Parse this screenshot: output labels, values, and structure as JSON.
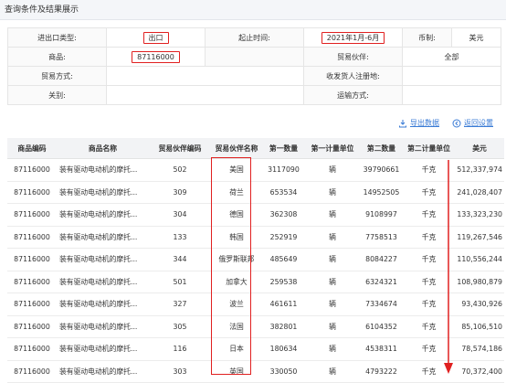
{
  "header": {
    "title": "查询条件及结果展示"
  },
  "criteria": {
    "trade_type_label": "进出口类型:",
    "trade_type_value": "出口",
    "period_label": "起止时间:",
    "period_value": "2021年1月-6月",
    "currency_label": "币制:",
    "currency_value": "美元",
    "product_label": "商品:",
    "product_value": "87116000",
    "partner_label": "贸易伙伴:",
    "partner_value": "全部",
    "trade_mode_label": "贸易方式:",
    "trade_mode_value": "",
    "registration_label": "收发货人注册地:",
    "registration_value": "",
    "customs_label": "关别:",
    "customs_value": "",
    "transport_label": "运输方式:",
    "transport_value": ""
  },
  "actions": {
    "export_label": "导出数据",
    "reset_label": "返回设置"
  },
  "colors": {
    "highlight": "#e02020",
    "link": "#3a7bd5"
  },
  "table": {
    "columns": [
      "商品编码",
      "商品名称",
      "贸易伙伴编码",
      "贸易伙伴名称",
      "第一数量",
      "第一计量单位",
      "第二数量",
      "第二计量单位",
      "美元"
    ],
    "rows": [
      [
        "87116000",
        "装有驱动电动机的摩托...",
        "502",
        "美国",
        "3117090",
        "辆",
        "39790661",
        "千克",
        "512,337,974"
      ],
      [
        "87116000",
        "装有驱动电动机的摩托...",
        "309",
        "荷兰",
        "653534",
        "辆",
        "14952505",
        "千克",
        "241,028,407"
      ],
      [
        "87116000",
        "装有驱动电动机的摩托...",
        "304",
        "德国",
        "362308",
        "辆",
        "9108997",
        "千克",
        "133,323,230"
      ],
      [
        "87116000",
        "装有驱动电动机的摩托...",
        "133",
        "韩国",
        "252919",
        "辆",
        "7758513",
        "千克",
        "119,267,546"
      ],
      [
        "87116000",
        "装有驱动电动机的摩托...",
        "344",
        "俄罗斯联邦",
        "485649",
        "辆",
        "8084227",
        "千克",
        "110,556,244"
      ],
      [
        "87116000",
        "装有驱动电动机的摩托...",
        "501",
        "加拿大",
        "259538",
        "辆",
        "6324321",
        "千克",
        "108,980,879"
      ],
      [
        "87116000",
        "装有驱动电动机的摩托...",
        "327",
        "波兰",
        "461611",
        "辆",
        "7334674",
        "千克",
        "93,430,926"
      ],
      [
        "87116000",
        "装有驱动电动机的摩托...",
        "305",
        "法国",
        "382801",
        "辆",
        "6104352",
        "千克",
        "85,106,510"
      ],
      [
        "87116000",
        "装有驱动电动机的摩托...",
        "116",
        "日本",
        "180634",
        "辆",
        "4538311",
        "千克",
        "78,574,186"
      ],
      [
        "87116000",
        "装有驱动电动机的摩托...",
        "303",
        "英国",
        "330050",
        "辆",
        "4793222",
        "千克",
        "70,372,400"
      ]
    ]
  }
}
